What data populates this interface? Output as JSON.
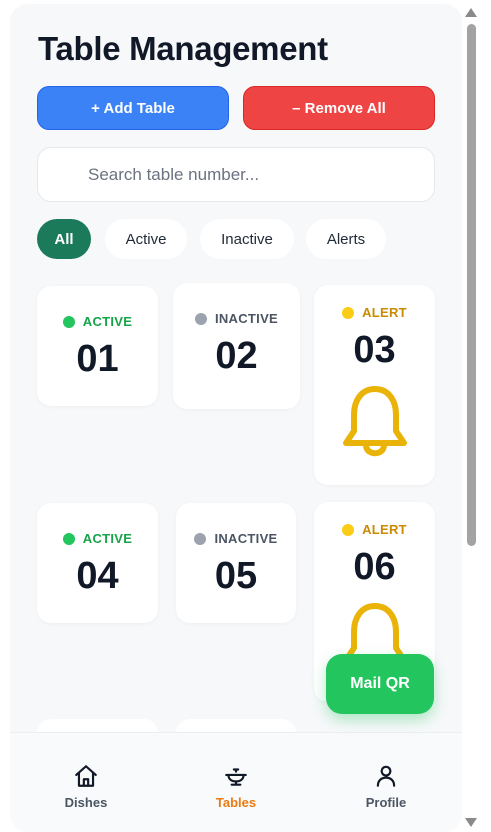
{
  "header": {
    "title": "Table Management"
  },
  "actions": {
    "add_label": "+ Add Table",
    "remove_label": "– Remove All"
  },
  "search": {
    "placeholder": "Search table number...",
    "value": ""
  },
  "filters": [
    {
      "label": "All",
      "selected": true
    },
    {
      "label": "Active",
      "selected": false
    },
    {
      "label": "Inactive",
      "selected": false
    },
    {
      "label": "Alerts",
      "selected": false
    }
  ],
  "tables": [
    {
      "number": "01",
      "status": "ACTIVE"
    },
    {
      "number": "02",
      "status": "INACTIVE"
    },
    {
      "number": "03",
      "status": "ALERT",
      "icon": "bell-icon"
    },
    {
      "number": "04",
      "status": "ACTIVE"
    },
    {
      "number": "05",
      "status": "INACTIVE"
    },
    {
      "number": "06",
      "status": "ALERT",
      "icon": "bell-icon"
    }
  ],
  "colors": {
    "active": "#16a34a",
    "active_dot": "#22c55e",
    "inactive": "#4b5563",
    "inactive_dot": "#9ca3af",
    "alert": "#ca8a04",
    "alert_dot": "#facc15",
    "bell": "#eab308",
    "add_button": "#3b82f6",
    "remove_button": "#ef4444",
    "filter_selected": "#1b7a5a",
    "mail_button": "#22c55e",
    "nav_current": "#ea7a12"
  },
  "fab": {
    "label": "Mail QR"
  },
  "nav": [
    {
      "label": "Dishes",
      "icon": "home-icon",
      "current": false
    },
    {
      "label": "Tables",
      "icon": "serving-tray-icon",
      "current": true
    },
    {
      "label": "Profile",
      "icon": "user-icon",
      "current": false
    }
  ]
}
